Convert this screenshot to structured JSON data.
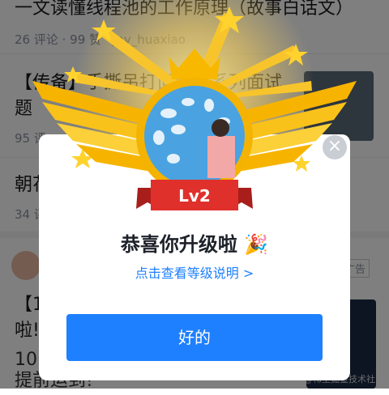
{
  "feed": {
    "item1": {
      "title": "一文读懂线程池的工作原理（故事白话文）",
      "meta": "26 评论 · 99 赞 · Jay_huaxiao"
    },
    "item2": {
      "title_line1": "【传备】手撕吊打面试官系列面试",
      "title_line2": "题",
      "meta": "95 评"
    },
    "item3": {
      "title": "朝花",
      "meta": "34 评"
    },
    "item4": {
      "title_line1": "【1",
      "title_line2": "啦!",
      "line3": "10.2",
      "line4": "提前运到!"
    },
    "ad_tag": "广告",
    "watermark": "@稀土掘金技术社区"
  },
  "dialog": {
    "level_badge": "Lv2",
    "congrats": "恭喜你升级啦",
    "party_icon": "🎉",
    "link_text": "点击查看等级说明 >",
    "ok_button": "好的",
    "close_icon": "×"
  },
  "colors": {
    "accent": "#1e80ff",
    "gold": "#f5b400",
    "ribbon": "#e0302b"
  }
}
